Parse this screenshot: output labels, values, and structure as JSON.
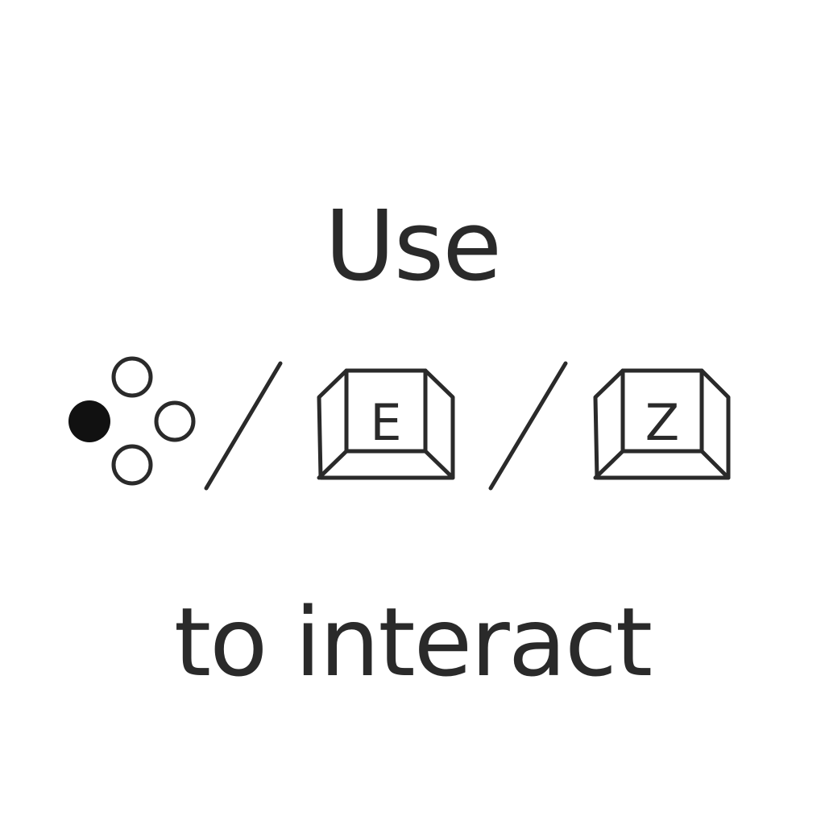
{
  "prompt": {
    "line1": "Use",
    "line2": "to interact",
    "separator": "/",
    "options": [
      {
        "type": "gamepad-face-buttons",
        "highlighted_button": "left",
        "icon": "gamepad-buttons-icon"
      },
      {
        "type": "keyboard-key",
        "key": "E",
        "icon": "keyboard-key-icon"
      },
      {
        "type": "keyboard-key",
        "key": "Z",
        "icon": "keyboard-key-icon"
      }
    ]
  },
  "colors": {
    "background": "#ffffff",
    "ink": "#2a2a2a"
  }
}
